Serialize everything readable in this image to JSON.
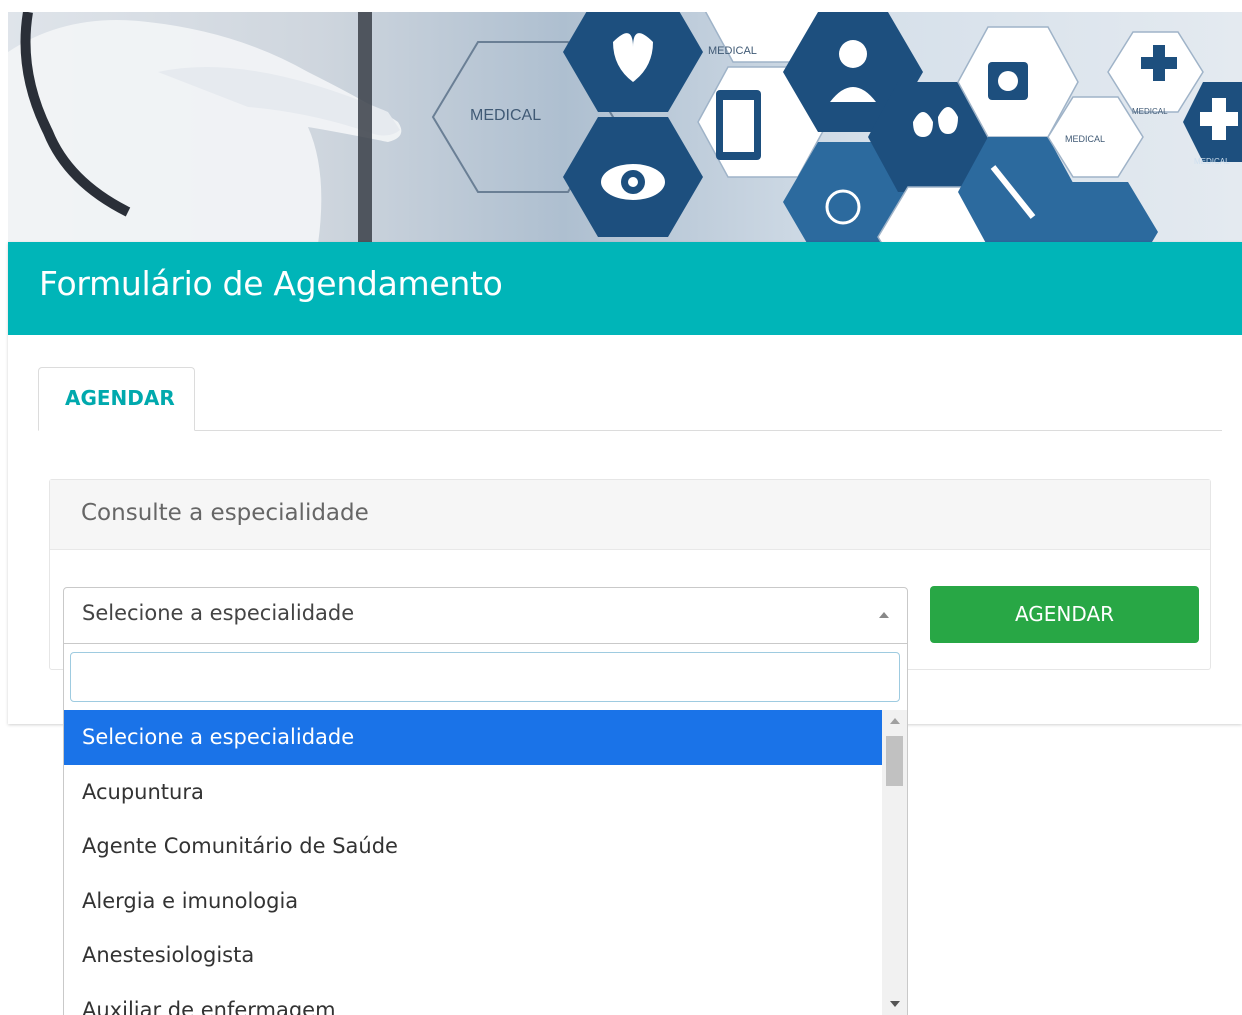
{
  "banner": {
    "label_1": "MEDICAL",
    "label_2": "MEDICAL",
    "label_3": "MEDICAL",
    "label_4": "MEDICAL",
    "label_5": "MEDICAL"
  },
  "header": {
    "title": "Formulário de Agendamento"
  },
  "tabs": [
    {
      "label": "AGENDAR"
    }
  ],
  "panel": {
    "title": "Consulte a especialidade"
  },
  "select": {
    "selected_value": "Selecione a especialidade",
    "search_value": "",
    "options": [
      "Selecione a especialidade",
      "Acupuntura",
      "Agente Comunitário de Saúde",
      "Alergia e imunologia",
      "Anestesiologista",
      "Auxiliar de enfermagem"
    ],
    "highlighted_index": 0
  },
  "button": {
    "label": "AGENDAR"
  },
  "colors": {
    "header_bg": "#00b5b8",
    "tab_text": "#00a9ad",
    "button_bg": "#28a745",
    "highlight": "#1a73e8"
  }
}
